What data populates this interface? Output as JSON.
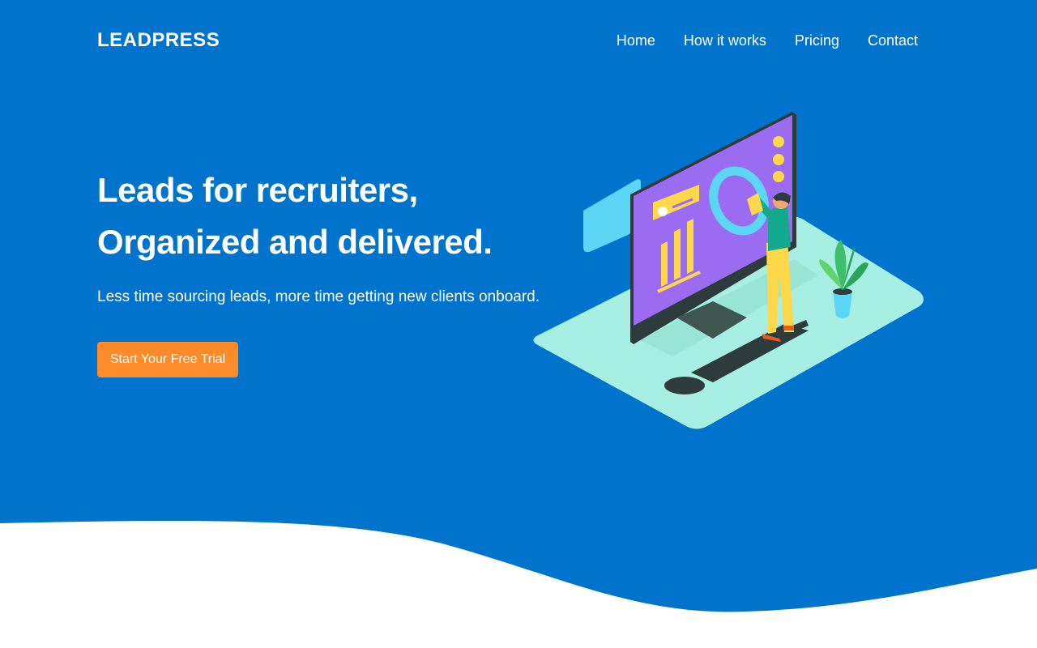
{
  "brand": {
    "name": "LEADPRESS"
  },
  "nav": {
    "items": [
      {
        "label": "Home"
      },
      {
        "label": "How it works"
      },
      {
        "label": "Pricing"
      },
      {
        "label": "Contact"
      }
    ]
  },
  "hero": {
    "headline_line1": "Leads for recruiters,",
    "headline_line2": "Organized and delivered.",
    "subheadline": "Less time sourcing leads, more time getting new clients onboard.",
    "cta_label": "Start Your Free Trial"
  },
  "colors": {
    "hero_background": "#0073cc",
    "cta_background": "#ff8a2a",
    "text": "#ffffff",
    "illustration_platform": "#a6efe2",
    "illustration_screen": "#9b6cf2"
  },
  "icons": [
    "workspace-illustration"
  ]
}
